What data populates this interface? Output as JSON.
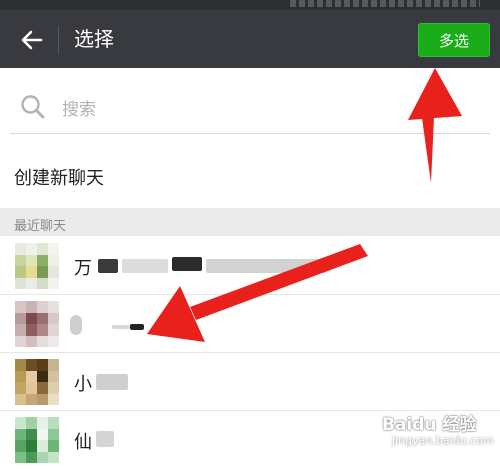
{
  "header": {
    "title": "选择",
    "multi_select_label": "多选"
  },
  "search": {
    "placeholder": "搜索"
  },
  "new_chat_label": "创建新聊天",
  "recent_section_label": "最近聊天",
  "contacts": [
    {
      "name": "万"
    },
    {
      "name": ""
    },
    {
      "name": "小"
    },
    {
      "name": "仙"
    }
  ],
  "watermark": {
    "text": "Baidu 经验",
    "sub": "jingyan.baidu.com"
  },
  "colors": {
    "titlebar": "#393a3f",
    "accent_green": "#1aad19",
    "annotation_red": "#e8211c",
    "section_bg": "#ebebeb"
  },
  "icons": [
    "back-arrow-icon",
    "search-icon"
  ]
}
